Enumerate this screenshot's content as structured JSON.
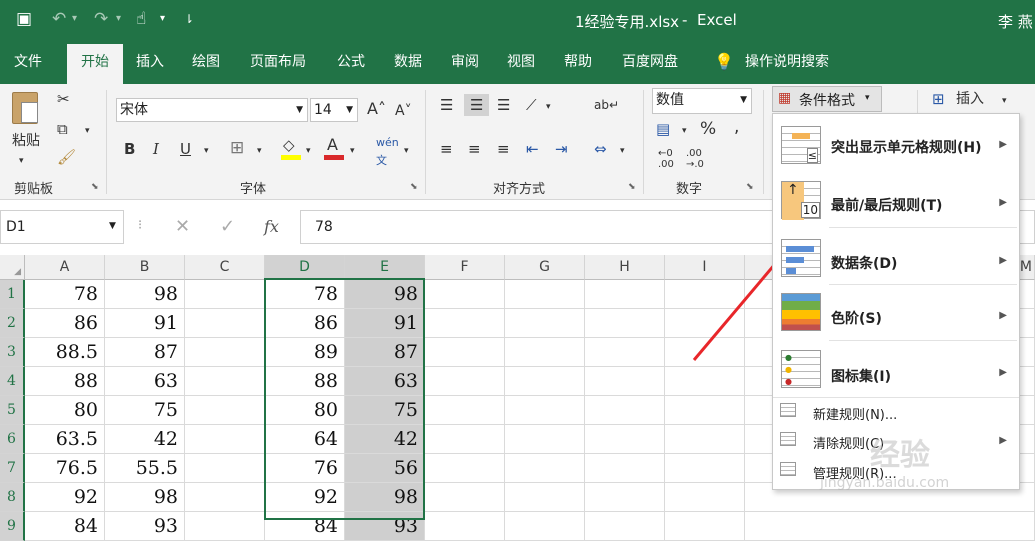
{
  "title": {
    "filename": "1经验专用.xlsx",
    "app": "Excel",
    "user": "李 燕"
  },
  "tabs": [
    "文件",
    "开始",
    "插入",
    "绘图",
    "页面布局",
    "公式",
    "数据",
    "审阅",
    "视图",
    "帮助",
    "百度网盘"
  ],
  "tell_me": "操作说明搜索",
  "ribbon": {
    "paste": "粘贴",
    "clipboard": "剪贴板",
    "font_name": "宋体",
    "font_size": "14",
    "font_group": "字体",
    "align_group": "对齐方式",
    "number_format": "数值",
    "number_group": "数字",
    "cond_format": "条件格式",
    "insert": "插入",
    "font_color_accent": "#d9292b",
    "highlight_accent": "#ffff00"
  },
  "formula_bar": {
    "name_box": "D1",
    "fx": "fx",
    "value": "78"
  },
  "columns": [
    "A",
    "B",
    "C",
    "D",
    "E",
    "F",
    "G",
    "H",
    "I",
    "M"
  ],
  "rows": [
    "1",
    "2",
    "3",
    "4",
    "5",
    "6",
    "7",
    "8",
    "9"
  ],
  "col_a": [
    "78",
    "86",
    "88.5",
    "88",
    "80",
    "63.5",
    "76.5",
    "92",
    "84"
  ],
  "col_b": [
    "98",
    "91",
    "87",
    "63",
    "75",
    "42",
    "55.5",
    "98",
    "93"
  ],
  "col_d": [
    "78",
    "86",
    "89",
    "88",
    "80",
    "64",
    "76",
    "92",
    "84"
  ],
  "col_e": [
    "98",
    "91",
    "87",
    "63",
    "75",
    "42",
    "56",
    "98",
    "93"
  ],
  "menu": {
    "large": [
      {
        "label": "突出显示单元格规则(H)"
      },
      {
        "label": "最前/最后规则(T)",
        "badge": "10"
      },
      {
        "label": "数据条(D)"
      },
      {
        "label": "色阶(S)"
      },
      {
        "label": "图标集(I)"
      }
    ],
    "small": [
      {
        "label": "新建规则(N)..."
      },
      {
        "label": "清除规则(C)"
      },
      {
        "label": "管理规则(R)..."
      }
    ]
  },
  "watermark": {
    "main": "经验",
    "sub": "jingyan.baidu.com"
  },
  "colors": {
    "excel_green": "#217346",
    "arrow": "#e8262a"
  }
}
